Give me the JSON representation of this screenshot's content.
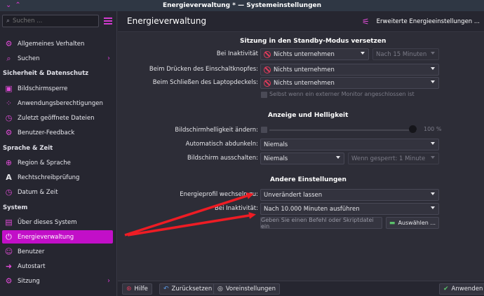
{
  "window": {
    "title": "Energieverwaltung * — Systemeinstellungen"
  },
  "sidebar": {
    "search_placeholder": "Suchen ...",
    "items": [
      {
        "label": "Allgemeines Verhalten",
        "chevron": false
      },
      {
        "label": "Suchen",
        "chevron": true
      },
      {
        "label": "Bildschirmsperre",
        "chevron": false
      },
      {
        "label": "Anwendungsberechtigungen",
        "chevron": false
      },
      {
        "label": "Zuletzt geöffnete Dateien",
        "chevron": false
      },
      {
        "label": "Benutzer-Feedback",
        "chevron": false
      },
      {
        "label": "Region & Sprache",
        "chevron": false
      },
      {
        "label": "Rechtschreibprüfung",
        "chevron": false
      },
      {
        "label": "Datum & Zeit",
        "chevron": false
      },
      {
        "label": "Über dieses System",
        "chevron": false
      },
      {
        "label": "Energieverwaltung",
        "chevron": false,
        "active": true
      },
      {
        "label": "Benutzer",
        "chevron": false
      },
      {
        "label": "Autostart",
        "chevron": false
      },
      {
        "label": "Sitzung",
        "chevron": true
      }
    ],
    "headers": {
      "privacy": "Sicherheit & Datenschutz",
      "language": "Sprache & Zeit",
      "system": "System"
    }
  },
  "header": {
    "title": "Energieverwaltung",
    "advanced_button": "Erweiterte Energieeinstellungen ..."
  },
  "standby": {
    "title": "Sitzung in den Standby-Modus versetzen",
    "idle_label": "Bei Inaktivität",
    "idle_value": "Nichts unternehmen",
    "idle_after": "Nach 15 Minuten",
    "power_button_label": "Beim Drücken des Einschaltknopfes:",
    "power_button_value": "Nichts unternehmen",
    "lid_label": "Beim Schließen des Laptopdeckels:",
    "lid_value": "Nichts unternehmen",
    "monitor_checkbox": "Selbst wenn ein externer Monitor angeschlossen ist"
  },
  "display": {
    "title": "Anzeige und Helligkeit",
    "brightness_label": "Bildschirmhelligkeit ändern:",
    "brightness_value": "100 %",
    "brightness_level": 1.0,
    "dim_label": "Automatisch abdunkeln:",
    "dim_value": "Niemals",
    "off_label": "Bildschirm ausschalten:",
    "off_value": "Niemals",
    "off_locked": "Wenn gesperrt: 1 Minute"
  },
  "other": {
    "title": "Andere Einstellungen",
    "profile_label": "Energieprofil wechseln zu:",
    "profile_value": "Unverändert lassen",
    "idle_label": "Bei Inaktivität:",
    "idle_value": "Nach 10.000 Minuten ausführen",
    "command_placeholder": "Geben Sie einen Befehl oder Skriptdatei ein",
    "choose_button": "Auswählen ..."
  },
  "footer": {
    "help": "Hilfe",
    "reset": "Zurücksetzen",
    "defaults": "Voreinstellungen",
    "apply": "Anwenden"
  },
  "colors": {
    "accent": "#c20fc8",
    "icon": "#e04bd7",
    "forbidden": "#e03b5b",
    "arrow": "#ee1c24",
    "apply_check": "#5bc06a"
  },
  "icons": {
    "menu": "hamburger-icon",
    "advanced": "sliders-icon",
    "search": "search-icon"
  }
}
